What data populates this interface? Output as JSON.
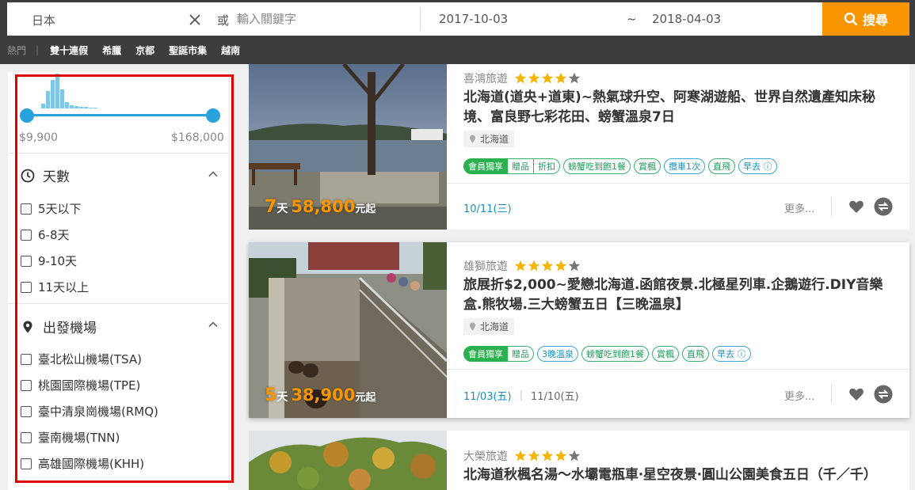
{
  "search": {
    "destination": "日本",
    "or_label": "或",
    "keyword_placeholder": "輸入關鍵字",
    "date_start": "2017-10-03",
    "date_separator": "~",
    "date_end": "2018-04-03",
    "search_button": "搜尋"
  },
  "hot": {
    "label": "熱門",
    "separator": "|",
    "links": [
      "雙十連假",
      "希臘",
      "京都",
      "聖誕市集",
      "越南"
    ]
  },
  "sidebar": {
    "price_min": "$9,900",
    "price_max": "$168,000",
    "days_section": {
      "title": "天數",
      "options": [
        "5天以下",
        "6-8天",
        "9-10天",
        "11天以上"
      ]
    },
    "airport_section": {
      "title": "出發機場",
      "options": [
        "臺北松山機場(TSA)",
        "桃園國際機場(TPE)",
        "臺中清泉崗機場(RMQ)",
        "臺南機場(TNN)",
        "高雄國際機場(KHH)"
      ]
    }
  },
  "products": [
    {
      "agency": "喜鴻旅遊",
      "rating": 4,
      "title": "北海道(道央+道東)~熱氣球升空、阿寒湖遊船、世界自然遺產知床秘境、富良野七彩花田、螃蟹溫泉7日",
      "location": "北海道",
      "days": "7",
      "days_unit": "天",
      "price": "58,800",
      "price_unit": "元起",
      "tags_member": "會員獨享",
      "tags_member_extra": [
        "贈品",
        "折扣"
      ],
      "tags": [
        "螃蟹吃到飽1餐",
        "賞楓",
        "攬車1次",
        "直飛",
        "早去 ⓘ"
      ],
      "dates": [
        "10/11(三)"
      ],
      "more": "更多..."
    },
    {
      "agency": "雄獅旅遊",
      "rating": 4,
      "title": "旅展折$2,000~愛戀北海道.函館夜景.北極星列車.企鵝遊行.DIY音樂盒.熊牧場.三大螃蟹五日【三晚溫泉】",
      "location": "北海道",
      "days": "5",
      "days_unit": "天",
      "price": "38,900",
      "price_unit": "元起",
      "tags_member": "會員獨享",
      "tags_member_extra": [
        "贈品"
      ],
      "tags": [
        "3晚溫泉",
        "螃蟹吃到飽1餐",
        "賞楓",
        "直飛",
        "早去 ⓘ"
      ],
      "dates": [
        "11/03(五)",
        "11/10(五)"
      ],
      "more": "更多..."
    },
    {
      "agency": "大榮旅遊",
      "rating": 4,
      "title": "北海道秋楓名湯～水壩電瓶車‧星空夜景‧圓山公園美食五日（千／千）"
    }
  ],
  "colors": {
    "accent": "#f99500",
    "slider": "#29a3dd",
    "frame": "#e00000",
    "tag_green": "#2bb04f",
    "link_blue": "#1a8fbf"
  }
}
